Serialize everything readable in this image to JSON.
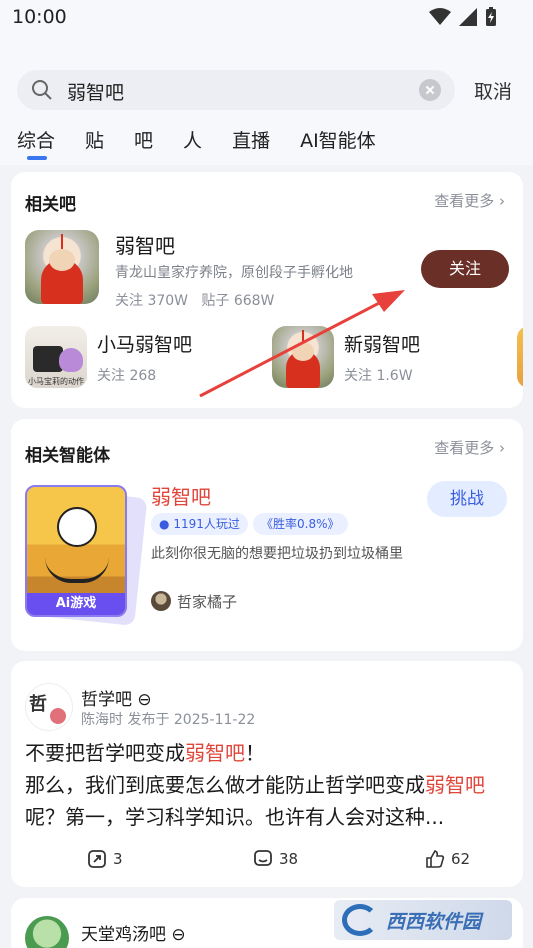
{
  "status_bar": {
    "time": "10:00"
  },
  "search": {
    "query": "弱智吧",
    "cancel_label": "取消"
  },
  "tabs": [
    {
      "label": "综合",
      "active": true
    },
    {
      "label": "贴"
    },
    {
      "label": "吧"
    },
    {
      "label": "人"
    },
    {
      "label": "直播"
    },
    {
      "label": "AI智能体"
    }
  ],
  "related_bars": {
    "title": "相关吧",
    "more_label": "查看更多",
    "main": {
      "name": "弱智吧",
      "description": "青龙山皇家疗养院，原创段子手孵化地",
      "followers": "关注 370W",
      "posts": "贴子 668W",
      "follow_label": "关注"
    },
    "others": [
      {
        "name": "小马弱智吧",
        "followers": "关注 268",
        "avatar_caption": "小马宝莉的动作"
      },
      {
        "name": "新弱智吧",
        "followers": "关注 1.6W"
      }
    ]
  },
  "related_agents": {
    "title": "相关智能体",
    "more_label": "查看更多",
    "agent": {
      "name": "弱智吧",
      "players": "1191人玩过",
      "win_rate": "胜率0.8%",
      "description": "此刻你很无脑的想要把垃圾扔到垃圾桶里",
      "author": "哲家橘子",
      "cover_label": "Ai游戏",
      "challenge_label": "挑战"
    }
  },
  "post": {
    "bar_name": "哲学吧",
    "author": "陈海时",
    "published": "发布于 2025-11-22",
    "avatar_char": "哲",
    "text_parts": {
      "p1": "不要把哲学吧变成",
      "h1": "弱智吧",
      "p2": "！",
      "p3": "那么，我们到底要怎么做才能防止哲学吧变成",
      "h2": "弱智吧",
      "p4": "呢？第一，学习科学知识。也许有人会对这种..."
    },
    "shares": "3",
    "comments": "38",
    "likes": "62"
  },
  "next_post": {
    "bar_name": "天堂鸡汤吧"
  },
  "watermark": {
    "text": "西西软件园"
  },
  "colors": {
    "accent": "#3a76f0",
    "follow_button": "#6a3028",
    "highlight": "#e0453a",
    "arrow": "#e8403a"
  }
}
